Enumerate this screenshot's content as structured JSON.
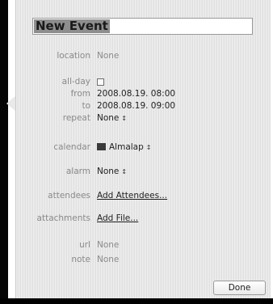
{
  "event": {
    "title": "New Event",
    "location_label": "location",
    "location_value": "None",
    "allday_label": "all-day",
    "from_label": "from",
    "from_value": "2008.08.19. 08:00",
    "to_label": "to",
    "to_value": "2008.08.19. 09:00",
    "repeat_label": "repeat",
    "repeat_value": "None",
    "calendar_label": "calendar",
    "calendar_value": "Almalap",
    "alarm_label": "alarm",
    "alarm_value": "None",
    "attendees_label": "attendees",
    "attendees_link": "Add Attendees...",
    "attachments_label": "attachments",
    "attachments_link": "Add File...",
    "url_label": "url",
    "url_value": "None",
    "note_label": "note",
    "note_value": "None",
    "done_label": "Done"
  },
  "icons": {
    "allday_checkbox": "checkbox-unchecked-icon",
    "repeat_stepper": "up-down-arrows-icon",
    "calendar_color": "calendar-color-swatch-icon",
    "calendar_stepper": "up-down-arrows-icon",
    "alarm_stepper": "up-down-arrows-icon"
  },
  "colors": {
    "panel_background": "#e8e8e8",
    "title_selection": "#8e8e8e",
    "calendar_swatch": "#3a3a3a"
  }
}
